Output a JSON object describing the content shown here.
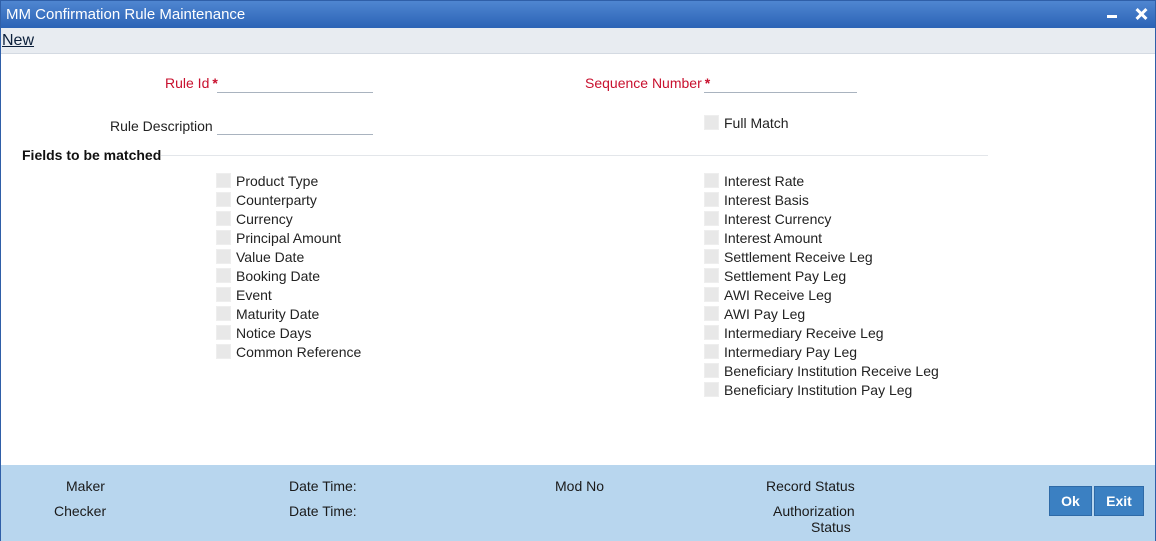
{
  "window": {
    "title": "MM Confirmation Rule Maintenance"
  },
  "menu": {
    "new_label": "New"
  },
  "form": {
    "rule_id_label": "Rule Id",
    "rule_id_value": "",
    "sequence_number_label": "Sequence Number",
    "sequence_number_value": "",
    "rule_description_label": "Rule Description",
    "rule_description_value": "",
    "full_match_label": "Full Match",
    "required_marker": "*"
  },
  "section": {
    "title": "Fields to be matched"
  },
  "left_fields": [
    "Product Type",
    "Counterparty",
    "Currency",
    "Principal Amount",
    "Value Date",
    "Booking Date",
    "Event",
    "Maturity Date",
    "Notice Days",
    "Common Reference"
  ],
  "right_fields": [
    "Interest Rate",
    "Interest Basis",
    "Interest Currency",
    "Interest Amount",
    "Settlement Receive Leg",
    "Settlement Pay Leg",
    "AWI Receive Leg",
    "AWI Pay Leg",
    "Intermediary Receive Leg",
    "Intermediary Pay Leg",
    "Beneficiary Institution Receive Leg",
    "Beneficiary Institution Pay Leg"
  ],
  "footer": {
    "maker": "Maker",
    "checker": "Checker",
    "date_time_1": "Date Time:",
    "date_time_2": "Date Time:",
    "mod_no": "Mod No",
    "record_status": "Record Status",
    "authorization": "Authorization",
    "status": "Status",
    "ok": "Ok",
    "exit": "Exit"
  }
}
